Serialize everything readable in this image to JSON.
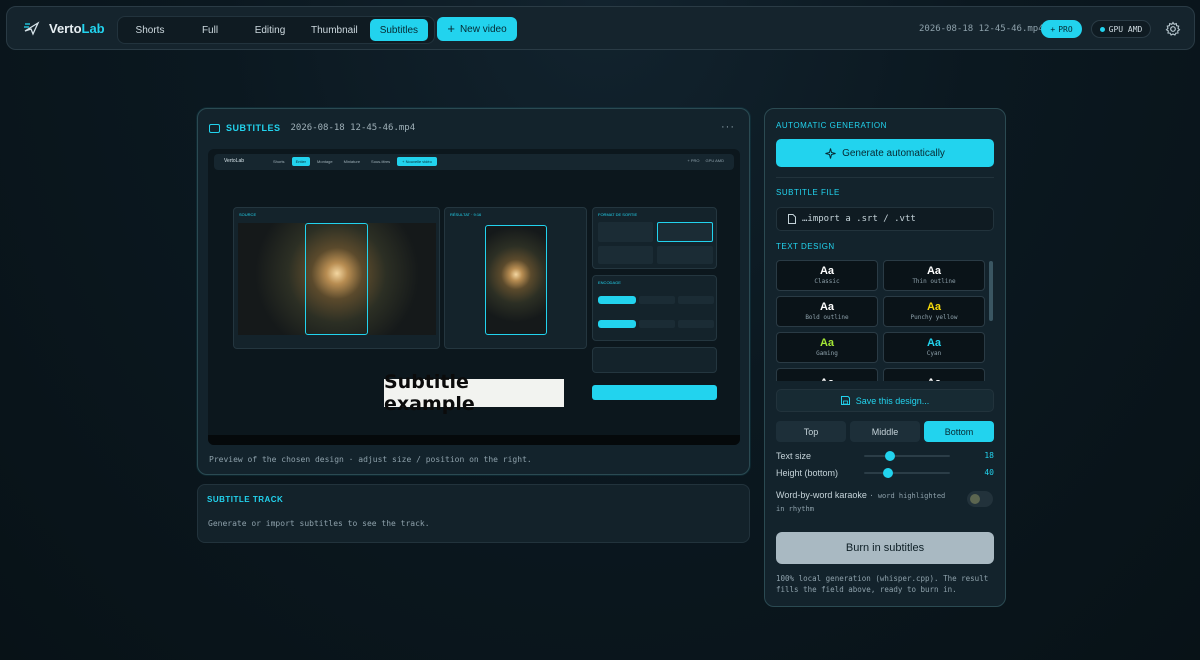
{
  "header": {
    "brand": {
      "part1": "Verto",
      "part2": "Lab"
    },
    "tabs": [
      {
        "label": "Shorts"
      },
      {
        "label": "Full"
      },
      {
        "label": "Editing"
      },
      {
        "label": "Thumbnail"
      },
      {
        "label": "Subtitles",
        "active": true
      }
    ],
    "new_video_label": "New video",
    "filename": "2026-08-18 12-45-46.mp4",
    "pro_badge": "PRO",
    "gpu_badge": "GPU AMD",
    "icons": {
      "brand": "film-plane-icon",
      "new": "plus-icon",
      "pro": "plus-icon",
      "gpu": "status-dot-icon",
      "settings": "gear-icon"
    },
    "accent_color": "#22d3ee"
  },
  "preview": {
    "title": "SUBTITLES",
    "filename": "2026-08-18 12-45-46.mp4",
    "more_label": "···",
    "subtitle_example": "Subtitle example",
    "caption": "Preview of the chosen design · adjust size / position on the right."
  },
  "track": {
    "title": "SUBTITLE TRACK",
    "empty_text": "Generate or import subtitles to see the track."
  },
  "side": {
    "auto_label": "AUTOMATIC GENERATION",
    "generate_label": "Generate automatically",
    "file_label": "SUBTITLE FILE",
    "import_placeholder": "…import a .srt / .vtt",
    "design_label": "TEXT DESIGN",
    "designs": [
      {
        "aa": "Aa",
        "name": "Classic",
        "color": "#ffffff"
      },
      {
        "aa": "Aa",
        "name": "Thin outline",
        "color": "#ffffff"
      },
      {
        "aa": "Aa",
        "name": "Bold outline",
        "color": "#ffffff"
      },
      {
        "aa": "Aa",
        "name": "Punchy yellow",
        "color": "#f5d90a"
      },
      {
        "aa": "Aa",
        "name": "Gaming",
        "color": "#a3e635"
      },
      {
        "aa": "Aa",
        "name": "Cyan",
        "color": "#22d3ee"
      },
      {
        "aa": "Aa",
        "name": "",
        "color": "#ffffff"
      },
      {
        "aa": "Aa",
        "name": "",
        "color": "#ffffff"
      }
    ],
    "save_design_label": "Save this design...",
    "positions": [
      {
        "label": "Top"
      },
      {
        "label": "Middle"
      },
      {
        "label": "Bottom",
        "active": true
      }
    ],
    "text_size": {
      "label": "Text size",
      "value": "18",
      "fraction": 0.3
    },
    "height_bottom": {
      "label": "Height (bottom)",
      "value": "40",
      "fraction": 0.28
    },
    "karaoke": {
      "label": "Word-by-word karaoke",
      "sub": "· word highlighted in rhythm",
      "enabled": false
    },
    "burn_label": "Burn in subtitles",
    "footnote": "100% local generation (whisper.cpp). The result fills the field above, ready to burn in."
  }
}
